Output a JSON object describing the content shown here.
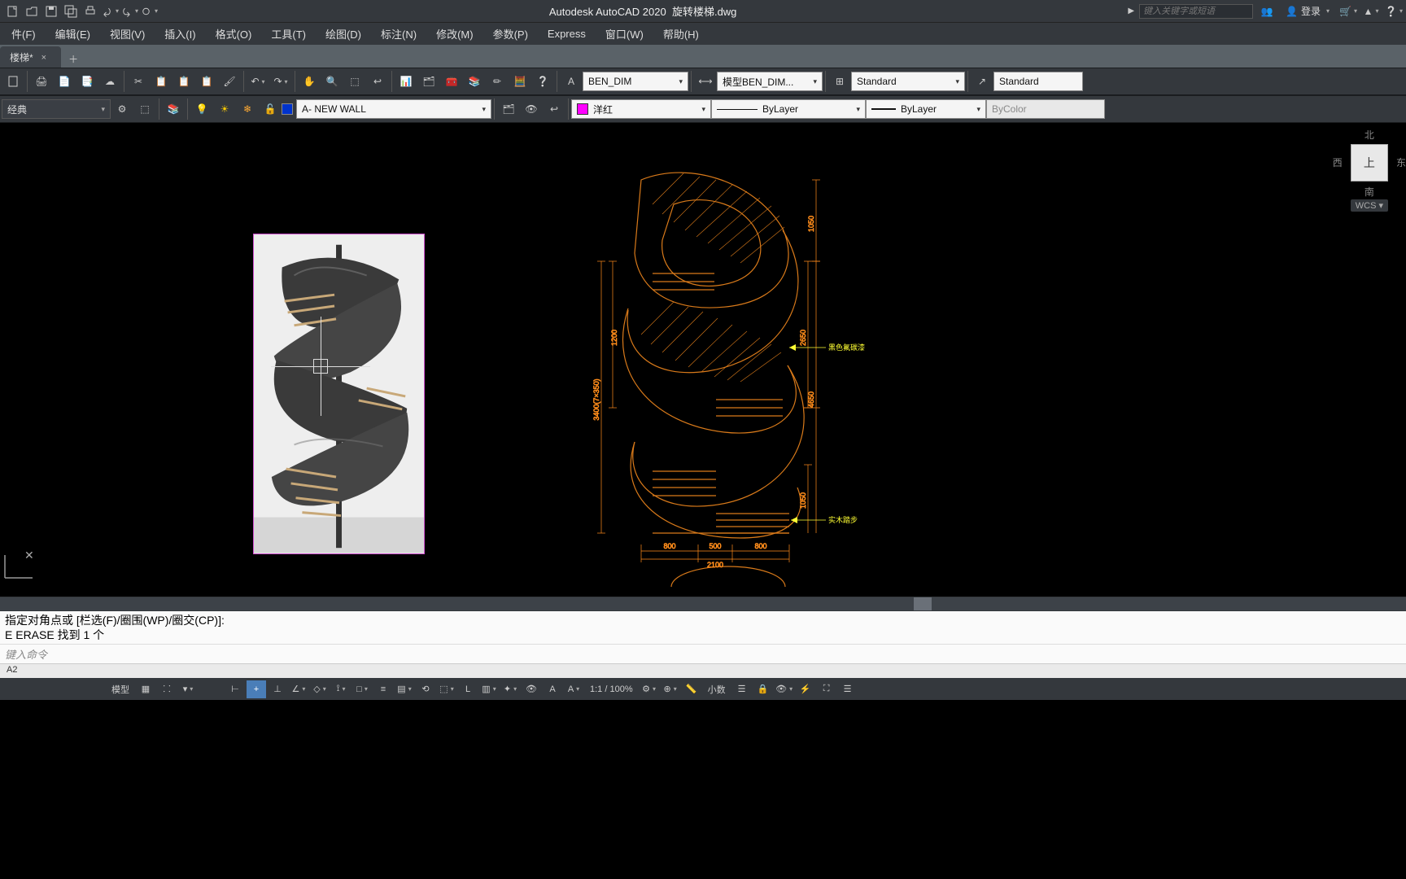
{
  "app": {
    "title_prefix": "Autodesk AutoCAD 2020",
    "doc": "旋转楼梯.dwg",
    "search_placeholder": "键入关键字或短语",
    "login_label": "登录"
  },
  "menu": {
    "items": [
      "件(F)",
      "编辑(E)",
      "视图(V)",
      "插入(I)",
      "格式(O)",
      "工具(T)",
      "绘图(D)",
      "标注(N)",
      "修改(M)",
      "参数(P)",
      "Express",
      "窗口(W)",
      "帮助(H)"
    ]
  },
  "tab": {
    "name": "楼梯*",
    "close": "×"
  },
  "toolbar1": {
    "textstyle": "BEN_DIM",
    "dimstyle": "模型BEN_DIM...",
    "tablestyle": "Standard",
    "standard": "Standard"
  },
  "toolbar2": {
    "workspace": "经典",
    "layer": "A- NEW WALL",
    "color_label": "洋红",
    "linetype": "ByLayer",
    "lineweight": "ByLayer",
    "plotstyle": "ByColor"
  },
  "navcube": {
    "up": "上",
    "north": "北",
    "south": "南",
    "east": "东",
    "west": "西",
    "wcs": "WCS"
  },
  "drawing": {
    "dims": {
      "h1": "1050",
      "h2": "2650",
      "h2b": "4650",
      "h3": "1200",
      "h4": "3400(7×350)",
      "h5": "1050",
      "w1": "800",
      "w2": "500",
      "w3": "800",
      "wtot": "2100"
    },
    "anno1": "黑色氟碳漆",
    "anno2": "实木踏步"
  },
  "cmd": {
    "line1": "指定对角点或 [栏选(F)/圈围(WP)/圈交(CP)]:",
    "line2a": "E",
    "line2b": "ERASE",
    "line2c": "找到 1 个",
    "input_placeholder": "键入命令",
    "layout": "A2"
  },
  "status": {
    "model": "模型",
    "zoom": "1:1 / 100%",
    "decimal": "小数"
  }
}
